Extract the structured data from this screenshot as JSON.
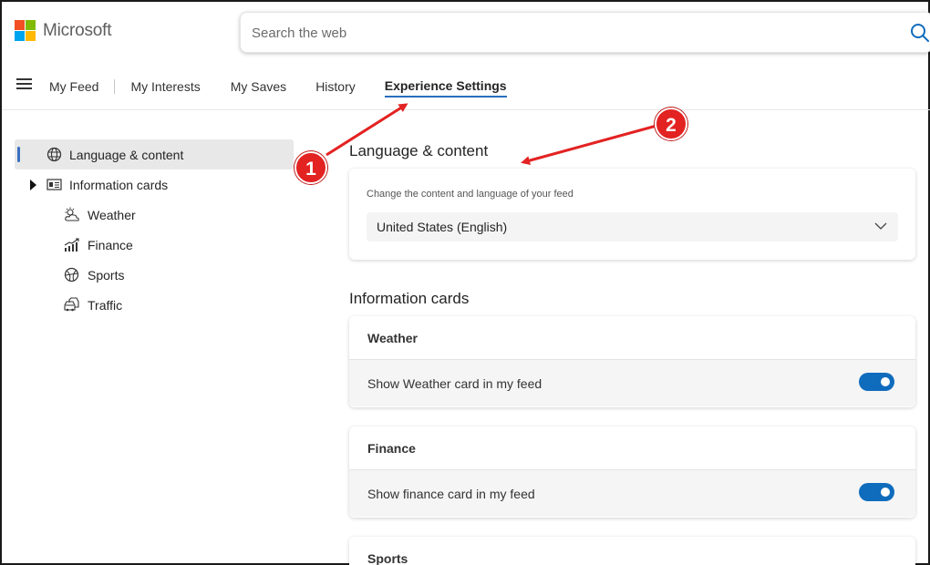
{
  "header": {
    "brand": "Microsoft",
    "search_placeholder": "Search the web"
  },
  "nav": {
    "tabs": [
      {
        "label": "My Feed"
      },
      {
        "label": "My Interests"
      },
      {
        "label": "My Saves"
      },
      {
        "label": "History"
      },
      {
        "label": "Experience Settings",
        "active": true
      }
    ]
  },
  "sidebar": {
    "items": [
      {
        "label": "Language & content",
        "icon": "globe-icon",
        "active": true
      },
      {
        "label": "Information cards",
        "icon": "cards-icon"
      },
      {
        "label": "Weather",
        "icon": "weather-icon"
      },
      {
        "label": "Finance",
        "icon": "finance-icon"
      },
      {
        "label": "Sports",
        "icon": "sports-icon"
      },
      {
        "label": "Traffic",
        "icon": "traffic-icon"
      }
    ]
  },
  "language": {
    "title": "Language & content",
    "caption": "Change the content and language of your feed",
    "selected": "United States (English)"
  },
  "info_cards": {
    "title": "Information cards",
    "cards": [
      {
        "name": "Weather",
        "toggle_label": "Show Weather card in my feed",
        "enabled": true
      },
      {
        "name": "Finance",
        "toggle_label": "Show finance card in my feed",
        "enabled": true
      },
      {
        "name": "Sports"
      }
    ]
  },
  "annotations": {
    "badge_1": "1",
    "badge_2": "2"
  },
  "colors": {
    "accent": "#0f6cbd",
    "annotation": "#e32222",
    "logo_red": "#f25022",
    "logo_green": "#7fba00",
    "logo_blue": "#00a4ef",
    "logo_yellow": "#ffb900"
  }
}
